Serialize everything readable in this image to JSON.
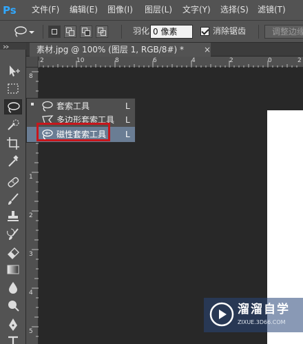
{
  "app": {
    "logo": "Ps"
  },
  "menubar": {
    "items": [
      {
        "label": "文件(F)"
      },
      {
        "label": "编辑(E)"
      },
      {
        "label": "图像(I)"
      },
      {
        "label": "图层(L)"
      },
      {
        "label": "文字(Y)"
      },
      {
        "label": "选择(S)"
      },
      {
        "label": "滤镜(T)"
      }
    ]
  },
  "options": {
    "feather_label": "羽化:",
    "feather_value": "0 像素",
    "antialias_checked": true,
    "antialias_label": "消除锯齿",
    "refine_label": "调整边缘"
  },
  "document_tab": {
    "title": "素材.jpg @ 100% (图层 1, RGB/8#) *",
    "close_glyph": "×"
  },
  "ruler": {
    "h_labels": [
      "2",
      "10",
      "8",
      "6",
      "4",
      "2",
      "0",
      "2"
    ],
    "v_labels": [
      "8",
      "1",
      "0",
      "1",
      "2",
      "3",
      "4",
      "5",
      "6"
    ]
  },
  "flyout": {
    "items": [
      {
        "label": "套索工具",
        "key": "L",
        "current": true,
        "icon": "lasso-icon"
      },
      {
        "label": "多边形套索工具",
        "key": "L",
        "current": false,
        "icon": "polygonal-lasso-icon"
      },
      {
        "label": "磁性套索工具",
        "key": "L",
        "current": false,
        "icon": "magnetic-lasso-icon",
        "highlighted": true
      }
    ]
  },
  "toolbox": {
    "tools": [
      "move-icon",
      "marquee-icon",
      "lasso-icon",
      "quick-select-icon",
      "crop-icon",
      "eyedropper-icon",
      "healing-brush-icon",
      "brush-icon",
      "clone-stamp-icon",
      "history-brush-icon",
      "eraser-icon",
      "gradient-icon",
      "blur-icon",
      "dodge-icon",
      "pen-icon",
      "type-icon"
    ]
  },
  "watermark": {
    "title": "溜溜自学",
    "url": "ZIXUE.3D66.COM"
  },
  "colors": {
    "chrome": "#535353",
    "canvas_bg": "#282828",
    "highlight": "#6a7d94",
    "annotation_red": "#c8161c",
    "ps_blue": "#31a8ff"
  }
}
